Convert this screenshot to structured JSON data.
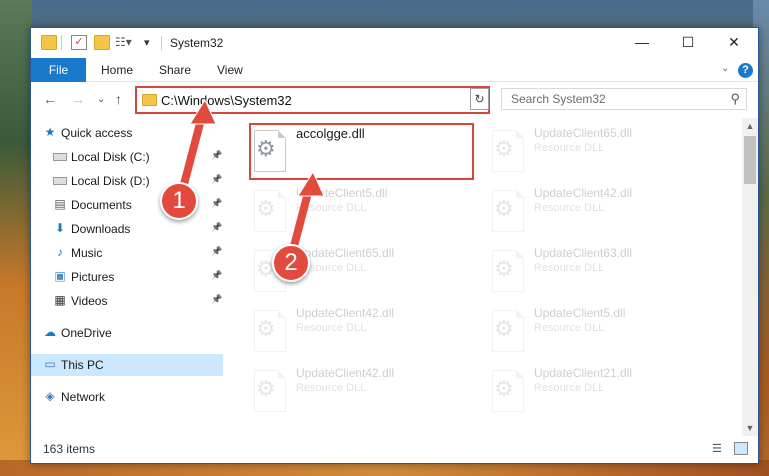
{
  "window": {
    "title": "System32",
    "controls": {
      "minimize": "—",
      "maximize": "☐",
      "close": "✕"
    }
  },
  "ribbon": {
    "file": "File",
    "tabs": [
      "Home",
      "Share",
      "View"
    ],
    "expand_icon": "chevron-down-icon",
    "help": "?"
  },
  "address": {
    "path": "C:\\Windows\\System32",
    "refresh": "↻"
  },
  "search": {
    "placeholder": "Search System32",
    "icon": "⚲"
  },
  "sidebar": {
    "items": [
      {
        "label": "Quick access",
        "icon": "star-icon",
        "glyph": "★",
        "pinned": false
      },
      {
        "label": "Local Disk (C:)",
        "icon": "drive-icon",
        "glyph": "",
        "pinned": true
      },
      {
        "label": "Local Disk (D:)",
        "icon": "drive-icon",
        "glyph": "",
        "pinned": true
      },
      {
        "label": "Documents",
        "icon": "document-icon",
        "glyph": "▤",
        "pinned": true
      },
      {
        "label": "Downloads",
        "icon": "download-icon",
        "glyph": "⬇",
        "pinned": true
      },
      {
        "label": "Music",
        "icon": "music-icon",
        "glyph": "♪",
        "pinned": true
      },
      {
        "label": "Pictures",
        "icon": "pictures-icon",
        "glyph": "▣",
        "pinned": true
      },
      {
        "label": "Videos",
        "icon": "video-icon",
        "glyph": "▦",
        "pinned": true
      },
      {
        "label": "OneDrive",
        "icon": "cloud-icon",
        "glyph": "☁",
        "pinned": false
      },
      {
        "label": "This PC",
        "icon": "computer-icon",
        "glyph": "▭",
        "pinned": false,
        "selected": true
      },
      {
        "label": "Network",
        "icon": "network-icon",
        "glyph": "◈",
        "pinned": false
      }
    ]
  },
  "files": [
    {
      "name": "accolgge.dll",
      "type": "",
      "highlighted": true
    },
    {
      "name": "UpdateClient65.dll",
      "type": "Resource DLL"
    },
    {
      "name": "UpdateClient5.dll",
      "type": "Resource DLL"
    },
    {
      "name": "UpdateClient42.dll",
      "type": "Resource DLL"
    },
    {
      "name": "UpdateClient65.dll",
      "type": "Resource DLL"
    },
    {
      "name": "UpdateClient63.dll",
      "type": "Resource DLL"
    },
    {
      "name": "UpdateClient42.dll",
      "type": "Resource DLL"
    },
    {
      "name": "UpdateClient5.dll",
      "type": "Resource DLL"
    },
    {
      "name": "UpdateClient42.dll",
      "type": "Resource DLL"
    },
    {
      "name": "UpdateClient21.dll",
      "type": "Resource DLL"
    }
  ],
  "status": {
    "count": "163 items"
  },
  "callouts": [
    "1",
    "2"
  ],
  "colors": {
    "accent": "#1979ca",
    "highlight": "#d9453a",
    "selected": "#cce8ff"
  }
}
